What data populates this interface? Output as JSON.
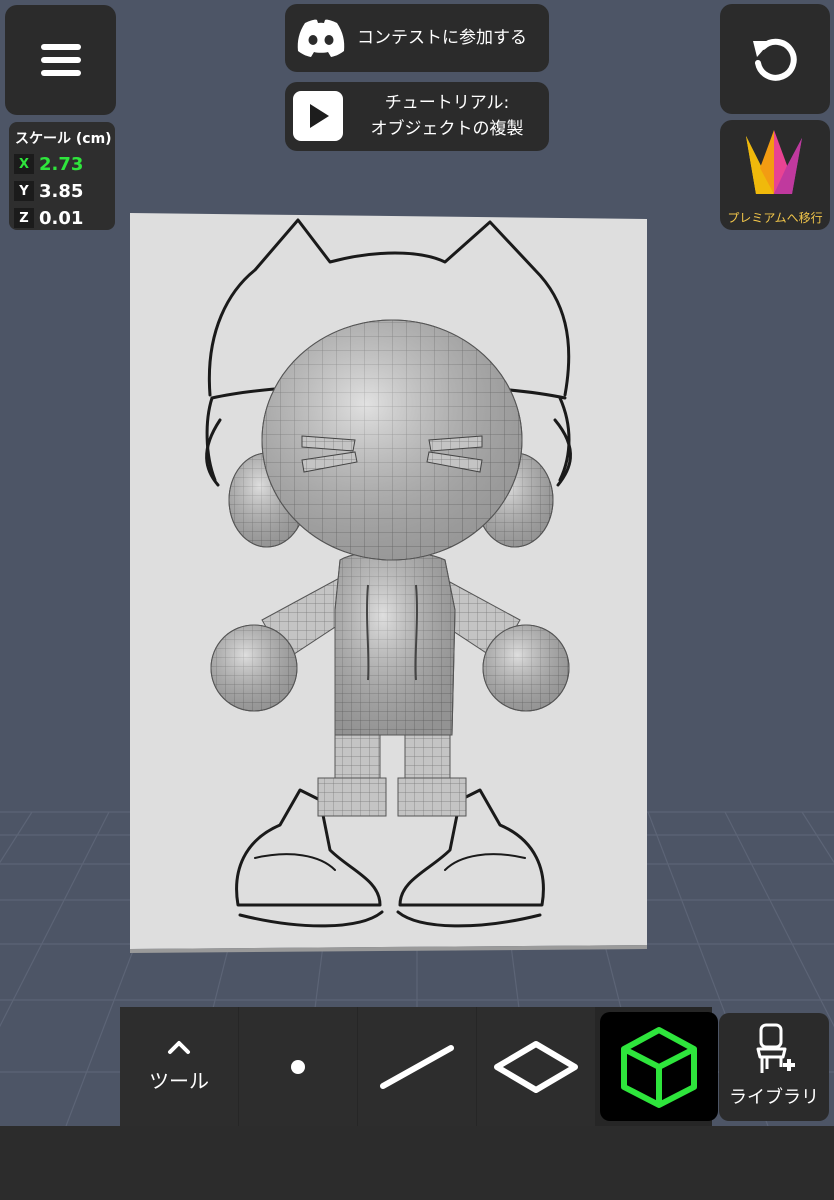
{
  "scale": {
    "title": "スケール (cm)",
    "x_label": "X",
    "x_value": "2.73",
    "y_label": "Y",
    "y_value": "3.85",
    "z_label": "Z",
    "z_value": "0.01"
  },
  "contest_button": {
    "label": "コンテストに参加する",
    "icon": "discord-icon"
  },
  "tutorial_button": {
    "line1": "チュートリアル:",
    "line2": "オブジェクトの複製",
    "icon": "play-icon"
  },
  "premium_button": {
    "label": "プレミアムへ移行",
    "icon": "crown-icon"
  },
  "undo_button": {
    "icon": "undo-icon"
  },
  "menu_button": {
    "icon": "hamburger-menu-icon"
  },
  "toolbar": {
    "tools_label": "ツール",
    "items": [
      "point-tool",
      "line-tool",
      "plane-tool",
      "cube-tool"
    ],
    "selected": "cube-tool"
  },
  "library_button": {
    "label": "ライブラリ",
    "icon": "chair-add-icon"
  },
  "colors": {
    "accent_green": "#2ee53c",
    "background": "#4d5566",
    "panel": "#2b2b2b",
    "premium_gold": "#f2c64a"
  }
}
